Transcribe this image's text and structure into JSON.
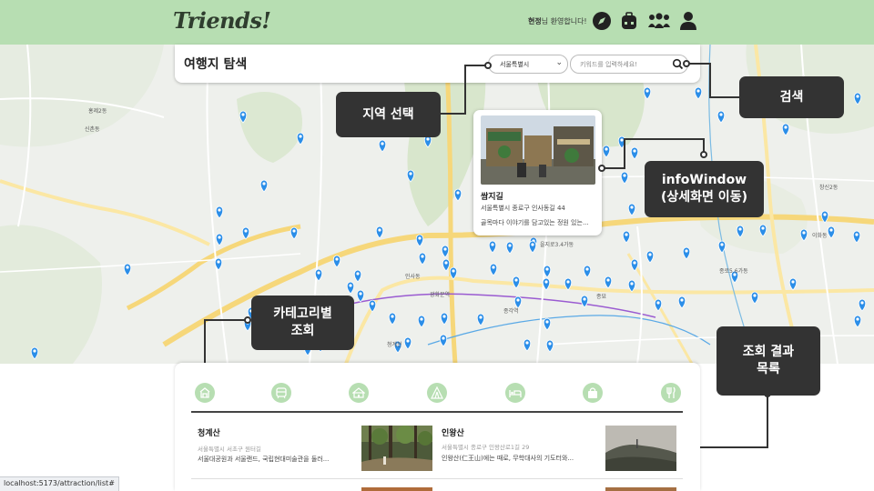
{
  "header": {
    "logo": "Triends!",
    "welcome_name": "현정",
    "welcome_suffix": "님 환영합니다!",
    "icons": [
      "compass-icon",
      "backpack-icon",
      "group-icon",
      "user-icon"
    ]
  },
  "search_panel": {
    "title": "여행지 탐색",
    "region_selected": "서울특별시",
    "search_placeholder": "키워드를 입력하세요!"
  },
  "info_window": {
    "name": "쌈지길",
    "address": "서울특별시 종로구 인사동길 44",
    "description": "골목마다 이야기를 담고있는 정원 있는..."
  },
  "annotations": {
    "region": "지역 선택",
    "search": "검색",
    "infowindow_line1": "infoWindow",
    "infowindow_line2": "(상세화면 이동)",
    "category_line1": "카테고리별",
    "category_line2": "조회",
    "results_line1": "조회 결과",
    "results_line2": "목록"
  },
  "categories": [
    "attraction-icon",
    "culture-icon",
    "festival-icon",
    "leisure-icon",
    "lodging-icon",
    "shopping-icon",
    "food-icon"
  ],
  "results": [
    {
      "title": "청계산",
      "address": "서울특별시 서초구 원터길",
      "description": "서울대공원과 서울랜드, 국립현대미술관을 둘러..."
    },
    {
      "title": "인왕산",
      "address": "서울특별시 종로구 인왕산로1길 29",
      "description": "인왕산(仁王山)에는 때로, 무학대사의 기도터와..."
    }
  ],
  "map_labels": {
    "jongno": "종로5.6가동",
    "insa": "인사동",
    "jongmyo": "종묘",
    "jonggak": "종각역",
    "gwanghwamun": "광화문역",
    "cheonggye": "청계천",
    "seoul_station": "서울역",
    "hongje": "홍제2동",
    "sinchon": "신촌동",
    "eulji": "을지로3.4가동",
    "changsin": "창신2동",
    "ehwa": "이화동"
  },
  "status_url": "localhost:5173/attraction/list#",
  "colors": {
    "header_bg": "#b7deb2",
    "callout_bg": "#333333",
    "marker": "#2b8ee8",
    "category_bg": "#b7deb2"
  }
}
